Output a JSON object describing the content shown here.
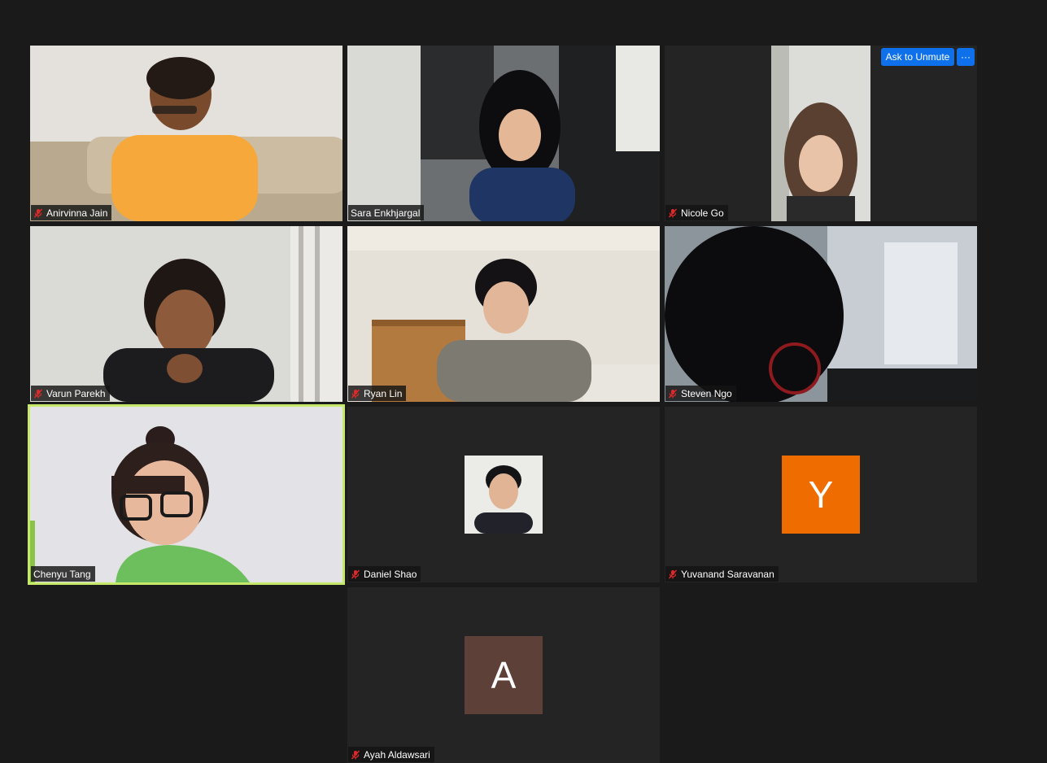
{
  "controls": {
    "ask_to_unmute_label": "Ask to Unmute",
    "more_label": "···"
  },
  "participants": [
    {
      "name": "Anirvinna Jain",
      "muted": true,
      "video": "on"
    },
    {
      "name": "Sara Enkhjargal",
      "muted": false,
      "video": "on"
    },
    {
      "name": "Nicole Go",
      "muted": true,
      "video": "on"
    },
    {
      "name": "Varun Parekh",
      "muted": true,
      "video": "on"
    },
    {
      "name": "Ryan Lin",
      "muted": true,
      "video": "on"
    },
    {
      "name": "Steven Ngo",
      "muted": true,
      "video": "on"
    },
    {
      "name": "Chenyu Tang",
      "muted": false,
      "video": "on",
      "active_speaker": true
    },
    {
      "name": "Daniel Shao",
      "muted": true,
      "video": "off",
      "display": "profile-photo"
    },
    {
      "name": "Yuvanand Saravanan",
      "muted": true,
      "video": "off",
      "avatar_letter": "Y",
      "avatar_color": "#ef6c00"
    },
    {
      "name": "Ayah Aldawsari",
      "muted": true,
      "video": "off",
      "avatar_letter": "A",
      "avatar_color": "#5d4037"
    }
  ],
  "colors": {
    "background": "#1a1a1a",
    "tile": "#242424",
    "active_speaker_border": "#c6e86b",
    "muted_icon": "#e02828",
    "button_blue": "#0e71eb"
  }
}
